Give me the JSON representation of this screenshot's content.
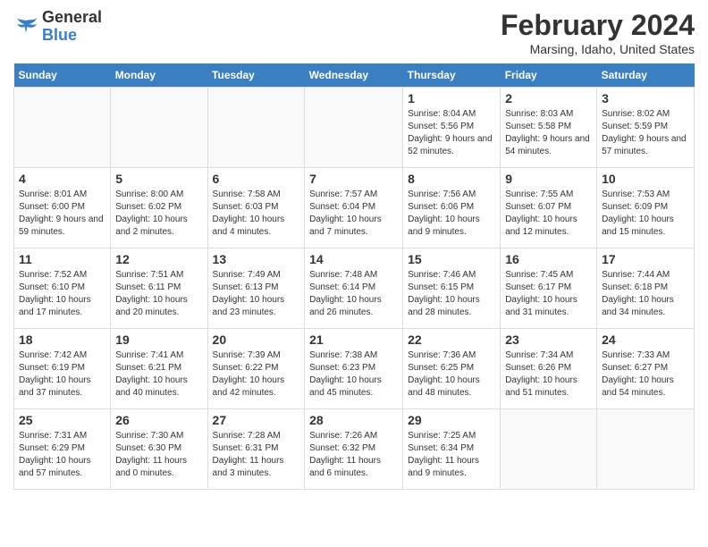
{
  "logo": {
    "general": "General",
    "blue": "Blue"
  },
  "header": {
    "month_year": "February 2024",
    "location": "Marsing, Idaho, United States"
  },
  "weekdays": [
    "Sunday",
    "Monday",
    "Tuesday",
    "Wednesday",
    "Thursday",
    "Friday",
    "Saturday"
  ],
  "weeks": [
    [
      {
        "day": "",
        "sunrise": "",
        "sunset": "",
        "daylight": ""
      },
      {
        "day": "",
        "sunrise": "",
        "sunset": "",
        "daylight": ""
      },
      {
        "day": "",
        "sunrise": "",
        "sunset": "",
        "daylight": ""
      },
      {
        "day": "",
        "sunrise": "",
        "sunset": "",
        "daylight": ""
      },
      {
        "day": "1",
        "sunrise": "Sunrise: 8:04 AM",
        "sunset": "Sunset: 5:56 PM",
        "daylight": "Daylight: 9 hours and 52 minutes."
      },
      {
        "day": "2",
        "sunrise": "Sunrise: 8:03 AM",
        "sunset": "Sunset: 5:58 PM",
        "daylight": "Daylight: 9 hours and 54 minutes."
      },
      {
        "day": "3",
        "sunrise": "Sunrise: 8:02 AM",
        "sunset": "Sunset: 5:59 PM",
        "daylight": "Daylight: 9 hours and 57 minutes."
      }
    ],
    [
      {
        "day": "4",
        "sunrise": "Sunrise: 8:01 AM",
        "sunset": "Sunset: 6:00 PM",
        "daylight": "Daylight: 9 hours and 59 minutes."
      },
      {
        "day": "5",
        "sunrise": "Sunrise: 8:00 AM",
        "sunset": "Sunset: 6:02 PM",
        "daylight": "Daylight: 10 hours and 2 minutes."
      },
      {
        "day": "6",
        "sunrise": "Sunrise: 7:58 AM",
        "sunset": "Sunset: 6:03 PM",
        "daylight": "Daylight: 10 hours and 4 minutes."
      },
      {
        "day": "7",
        "sunrise": "Sunrise: 7:57 AM",
        "sunset": "Sunset: 6:04 PM",
        "daylight": "Daylight: 10 hours and 7 minutes."
      },
      {
        "day": "8",
        "sunrise": "Sunrise: 7:56 AM",
        "sunset": "Sunset: 6:06 PM",
        "daylight": "Daylight: 10 hours and 9 minutes."
      },
      {
        "day": "9",
        "sunrise": "Sunrise: 7:55 AM",
        "sunset": "Sunset: 6:07 PM",
        "daylight": "Daylight: 10 hours and 12 minutes."
      },
      {
        "day": "10",
        "sunrise": "Sunrise: 7:53 AM",
        "sunset": "Sunset: 6:09 PM",
        "daylight": "Daylight: 10 hours and 15 minutes."
      }
    ],
    [
      {
        "day": "11",
        "sunrise": "Sunrise: 7:52 AM",
        "sunset": "Sunset: 6:10 PM",
        "daylight": "Daylight: 10 hours and 17 minutes."
      },
      {
        "day": "12",
        "sunrise": "Sunrise: 7:51 AM",
        "sunset": "Sunset: 6:11 PM",
        "daylight": "Daylight: 10 hours and 20 minutes."
      },
      {
        "day": "13",
        "sunrise": "Sunrise: 7:49 AM",
        "sunset": "Sunset: 6:13 PM",
        "daylight": "Daylight: 10 hours and 23 minutes."
      },
      {
        "day": "14",
        "sunrise": "Sunrise: 7:48 AM",
        "sunset": "Sunset: 6:14 PM",
        "daylight": "Daylight: 10 hours and 26 minutes."
      },
      {
        "day": "15",
        "sunrise": "Sunrise: 7:46 AM",
        "sunset": "Sunset: 6:15 PM",
        "daylight": "Daylight: 10 hours and 28 minutes."
      },
      {
        "day": "16",
        "sunrise": "Sunrise: 7:45 AM",
        "sunset": "Sunset: 6:17 PM",
        "daylight": "Daylight: 10 hours and 31 minutes."
      },
      {
        "day": "17",
        "sunrise": "Sunrise: 7:44 AM",
        "sunset": "Sunset: 6:18 PM",
        "daylight": "Daylight: 10 hours and 34 minutes."
      }
    ],
    [
      {
        "day": "18",
        "sunrise": "Sunrise: 7:42 AM",
        "sunset": "Sunset: 6:19 PM",
        "daylight": "Daylight: 10 hours and 37 minutes."
      },
      {
        "day": "19",
        "sunrise": "Sunrise: 7:41 AM",
        "sunset": "Sunset: 6:21 PM",
        "daylight": "Daylight: 10 hours and 40 minutes."
      },
      {
        "day": "20",
        "sunrise": "Sunrise: 7:39 AM",
        "sunset": "Sunset: 6:22 PM",
        "daylight": "Daylight: 10 hours and 42 minutes."
      },
      {
        "day": "21",
        "sunrise": "Sunrise: 7:38 AM",
        "sunset": "Sunset: 6:23 PM",
        "daylight": "Daylight: 10 hours and 45 minutes."
      },
      {
        "day": "22",
        "sunrise": "Sunrise: 7:36 AM",
        "sunset": "Sunset: 6:25 PM",
        "daylight": "Daylight: 10 hours and 48 minutes."
      },
      {
        "day": "23",
        "sunrise": "Sunrise: 7:34 AM",
        "sunset": "Sunset: 6:26 PM",
        "daylight": "Daylight: 10 hours and 51 minutes."
      },
      {
        "day": "24",
        "sunrise": "Sunrise: 7:33 AM",
        "sunset": "Sunset: 6:27 PM",
        "daylight": "Daylight: 10 hours and 54 minutes."
      }
    ],
    [
      {
        "day": "25",
        "sunrise": "Sunrise: 7:31 AM",
        "sunset": "Sunset: 6:29 PM",
        "daylight": "Daylight: 10 hours and 57 minutes."
      },
      {
        "day": "26",
        "sunrise": "Sunrise: 7:30 AM",
        "sunset": "Sunset: 6:30 PM",
        "daylight": "Daylight: 11 hours and 0 minutes."
      },
      {
        "day": "27",
        "sunrise": "Sunrise: 7:28 AM",
        "sunset": "Sunset: 6:31 PM",
        "daylight": "Daylight: 11 hours and 3 minutes."
      },
      {
        "day": "28",
        "sunrise": "Sunrise: 7:26 AM",
        "sunset": "Sunset: 6:32 PM",
        "daylight": "Daylight: 11 hours and 6 minutes."
      },
      {
        "day": "29",
        "sunrise": "Sunrise: 7:25 AM",
        "sunset": "Sunset: 6:34 PM",
        "daylight": "Daylight: 11 hours and 9 minutes."
      },
      {
        "day": "",
        "sunrise": "",
        "sunset": "",
        "daylight": ""
      },
      {
        "day": "",
        "sunrise": "",
        "sunset": "",
        "daylight": ""
      }
    ]
  ]
}
